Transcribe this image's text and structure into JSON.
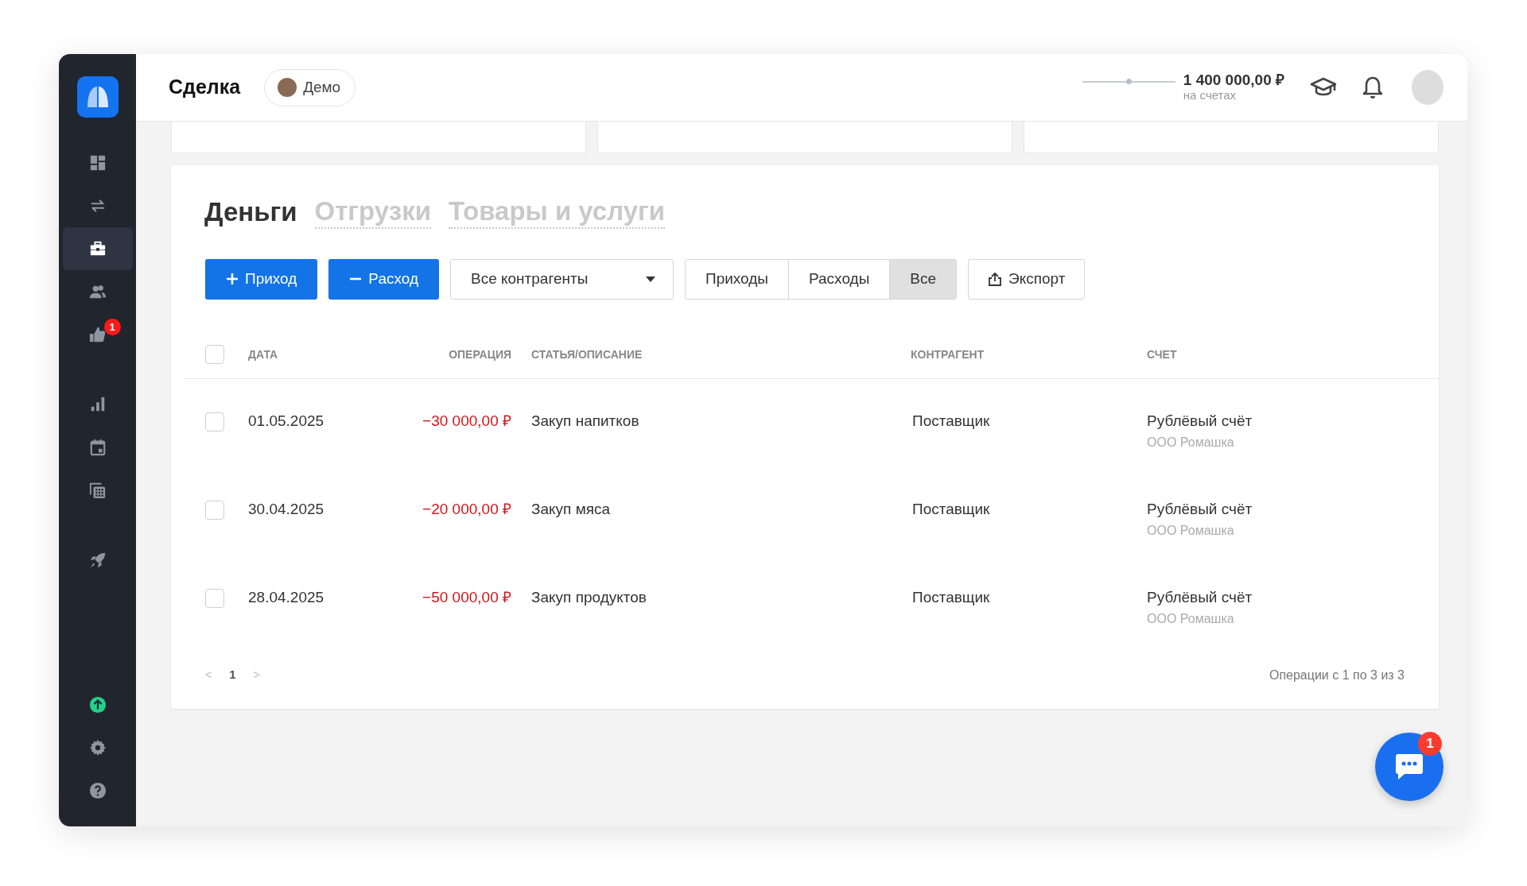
{
  "header": {
    "title": "Сделка",
    "demo_chip": {
      "label": "Демо"
    },
    "balance": {
      "level": 0.5,
      "amount": "1 400 000,00 ₽",
      "caption": "на счетах"
    }
  },
  "sidebar": {
    "groups": [
      {
        "items": [
          {
            "kind": "dashboard",
            "selected": false
          },
          {
            "kind": "transfers",
            "selected": false
          },
          {
            "kind": "briefcase",
            "selected": true
          },
          {
            "kind": "people",
            "selected": false
          },
          {
            "kind": "thumbs",
            "selected": false,
            "badge": "1"
          }
        ]
      },
      {
        "items": [
          {
            "kind": "chart",
            "selected": false
          },
          {
            "kind": "calendar",
            "selected": false
          },
          {
            "kind": "calculator",
            "selected": false
          }
        ]
      },
      {
        "items": [
          {
            "kind": "rocket",
            "selected": false
          }
        ]
      }
    ],
    "bottom_items": [
      {
        "kind": "upload",
        "selected": false
      },
      {
        "kind": "settings",
        "selected": false
      },
      {
        "kind": "help",
        "selected": false
      }
    ]
  },
  "tabs": [
    {
      "label": "Деньги",
      "selected": true
    },
    {
      "label": "Отгрузки",
      "selected": false
    },
    {
      "label": "Товары и услуги",
      "selected": false
    }
  ],
  "toolbar": {
    "income_button": "Приход",
    "expense_button": "Расход",
    "counterparty_select": "Все контрагенты",
    "filters": [
      {
        "label": "Приходы",
        "selected": false
      },
      {
        "label": "Расходы",
        "selected": false
      },
      {
        "label": "Все",
        "selected": true
      }
    ],
    "export_button": "Экспорт"
  },
  "table": {
    "columns": [
      "ДАТА",
      "ОПЕРАЦИЯ",
      "СТАТЬЯ/ОПИСАНИЕ",
      "КОНТРАГЕНТ",
      "СЧЕТ"
    ],
    "select_all_checked": false,
    "rows": [
      {
        "checked": false,
        "date": "01.05.2025",
        "amount": "−30 000,00 ₽",
        "description": "Закуп напитков",
        "counterparty": "Поставщик",
        "account": "Рублёвый счёт",
        "account_owner": "ООО Ромашка"
      },
      {
        "checked": false,
        "date": "30.04.2025",
        "amount": "−20 000,00 ₽",
        "description": "Закуп мяса",
        "counterparty": "Поставщик",
        "account": "Рублёвый счёт",
        "account_owner": "ООО Ромашка"
      },
      {
        "checked": false,
        "date": "28.04.2025",
        "amount": "−50 000,00 ₽",
        "description": "Закуп продуктов",
        "counterparty": "Поставщик",
        "account": "Рублёвый счёт",
        "account_owner": "ООО Ромашка"
      }
    ]
  },
  "pagination": {
    "prev": "<",
    "pages": [
      {
        "label": "1",
        "selected": true
      }
    ],
    "next": ">",
    "summary": "Операции с 1 по 3 из 3"
  },
  "chat": {
    "badge": "1"
  }
}
